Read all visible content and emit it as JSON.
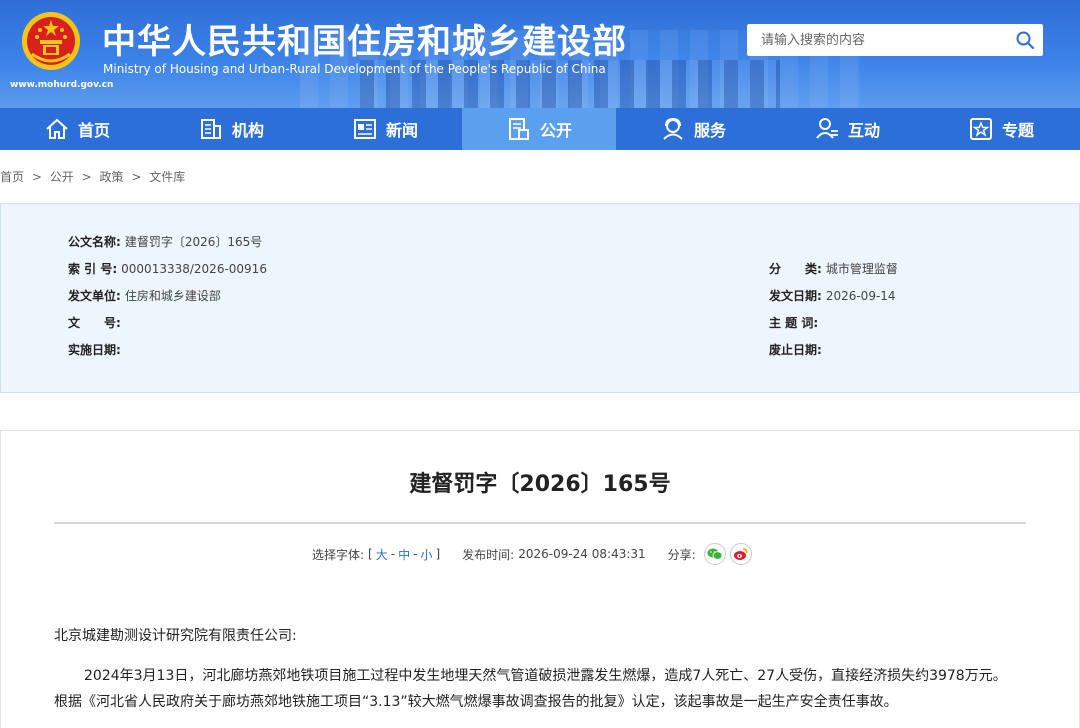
{
  "header": {
    "title": "中华人民共和国住房和城乡建设部",
    "subtitle": "Ministry of Housing and Urban-Rural Development of the People's Republic of China",
    "domain": "www.mohurd.gov.cn",
    "search_placeholder": "请输入搜索的内容"
  },
  "nav": [
    {
      "label": "首页",
      "icon": "home-icon"
    },
    {
      "label": "机构",
      "icon": "building-icon"
    },
    {
      "label": "新闻",
      "icon": "news-icon"
    },
    {
      "label": "公开",
      "icon": "document-icon",
      "active": true
    },
    {
      "label": "服务",
      "icon": "service-icon"
    },
    {
      "label": "互动",
      "icon": "interaction-icon"
    },
    {
      "label": "专题",
      "icon": "star-icon"
    }
  ],
  "breadcrumb": [
    "首页",
    ">",
    "公开",
    ">",
    "政策",
    ">",
    "文件库"
  ],
  "meta": {
    "doc_name_k": "公文名称:",
    "doc_name_v": "建督罚字〔2026〕165号",
    "index_k": "索 引 号:",
    "index_v": "000013338/2026-00916",
    "issuer_k": "发文单位:",
    "issuer_v": "住房和城乡建设部",
    "docno_k": "文　　号:",
    "docno_v": "",
    "effective_k": "实施日期:",
    "effective_v": "",
    "category_k": "分　　类:",
    "category_v": "城市管理监督",
    "date_k": "发文日期:",
    "date_v": "2026-09-14",
    "topic_k": "主 题 词:",
    "topic_v": "",
    "abolish_k": "废止日期:",
    "abolish_v": ""
  },
  "article": {
    "title": "建督罚字〔2026〕165号",
    "font_label": "选择字体:",
    "font_open": "[",
    "font_large": "大",
    "font_medium": "中",
    "font_small": "小",
    "font_sep": "-",
    "font_close": "]",
    "publish_label": "发布时间:",
    "publish_time": "2026-09-24 08:43:31",
    "share_label": "分享:",
    "addressee": "北京城建勘测设计研究院有限责任公司:",
    "para1_line1": "2024年3月13日，河北廊坊燕郊地铁项目施工过程中发生地埋天然气管道破损泄露发生燃爆，造成7人死亡、27人受伤，直接经济损失约3978万元。",
    "para1_line2": "根据《河北省人民政府关于廊坊燕郊地铁施工项目“3.13”较大燃气燃爆事故调查报告的批复》认定，该起事故是一起生产安全责任事故。"
  }
}
